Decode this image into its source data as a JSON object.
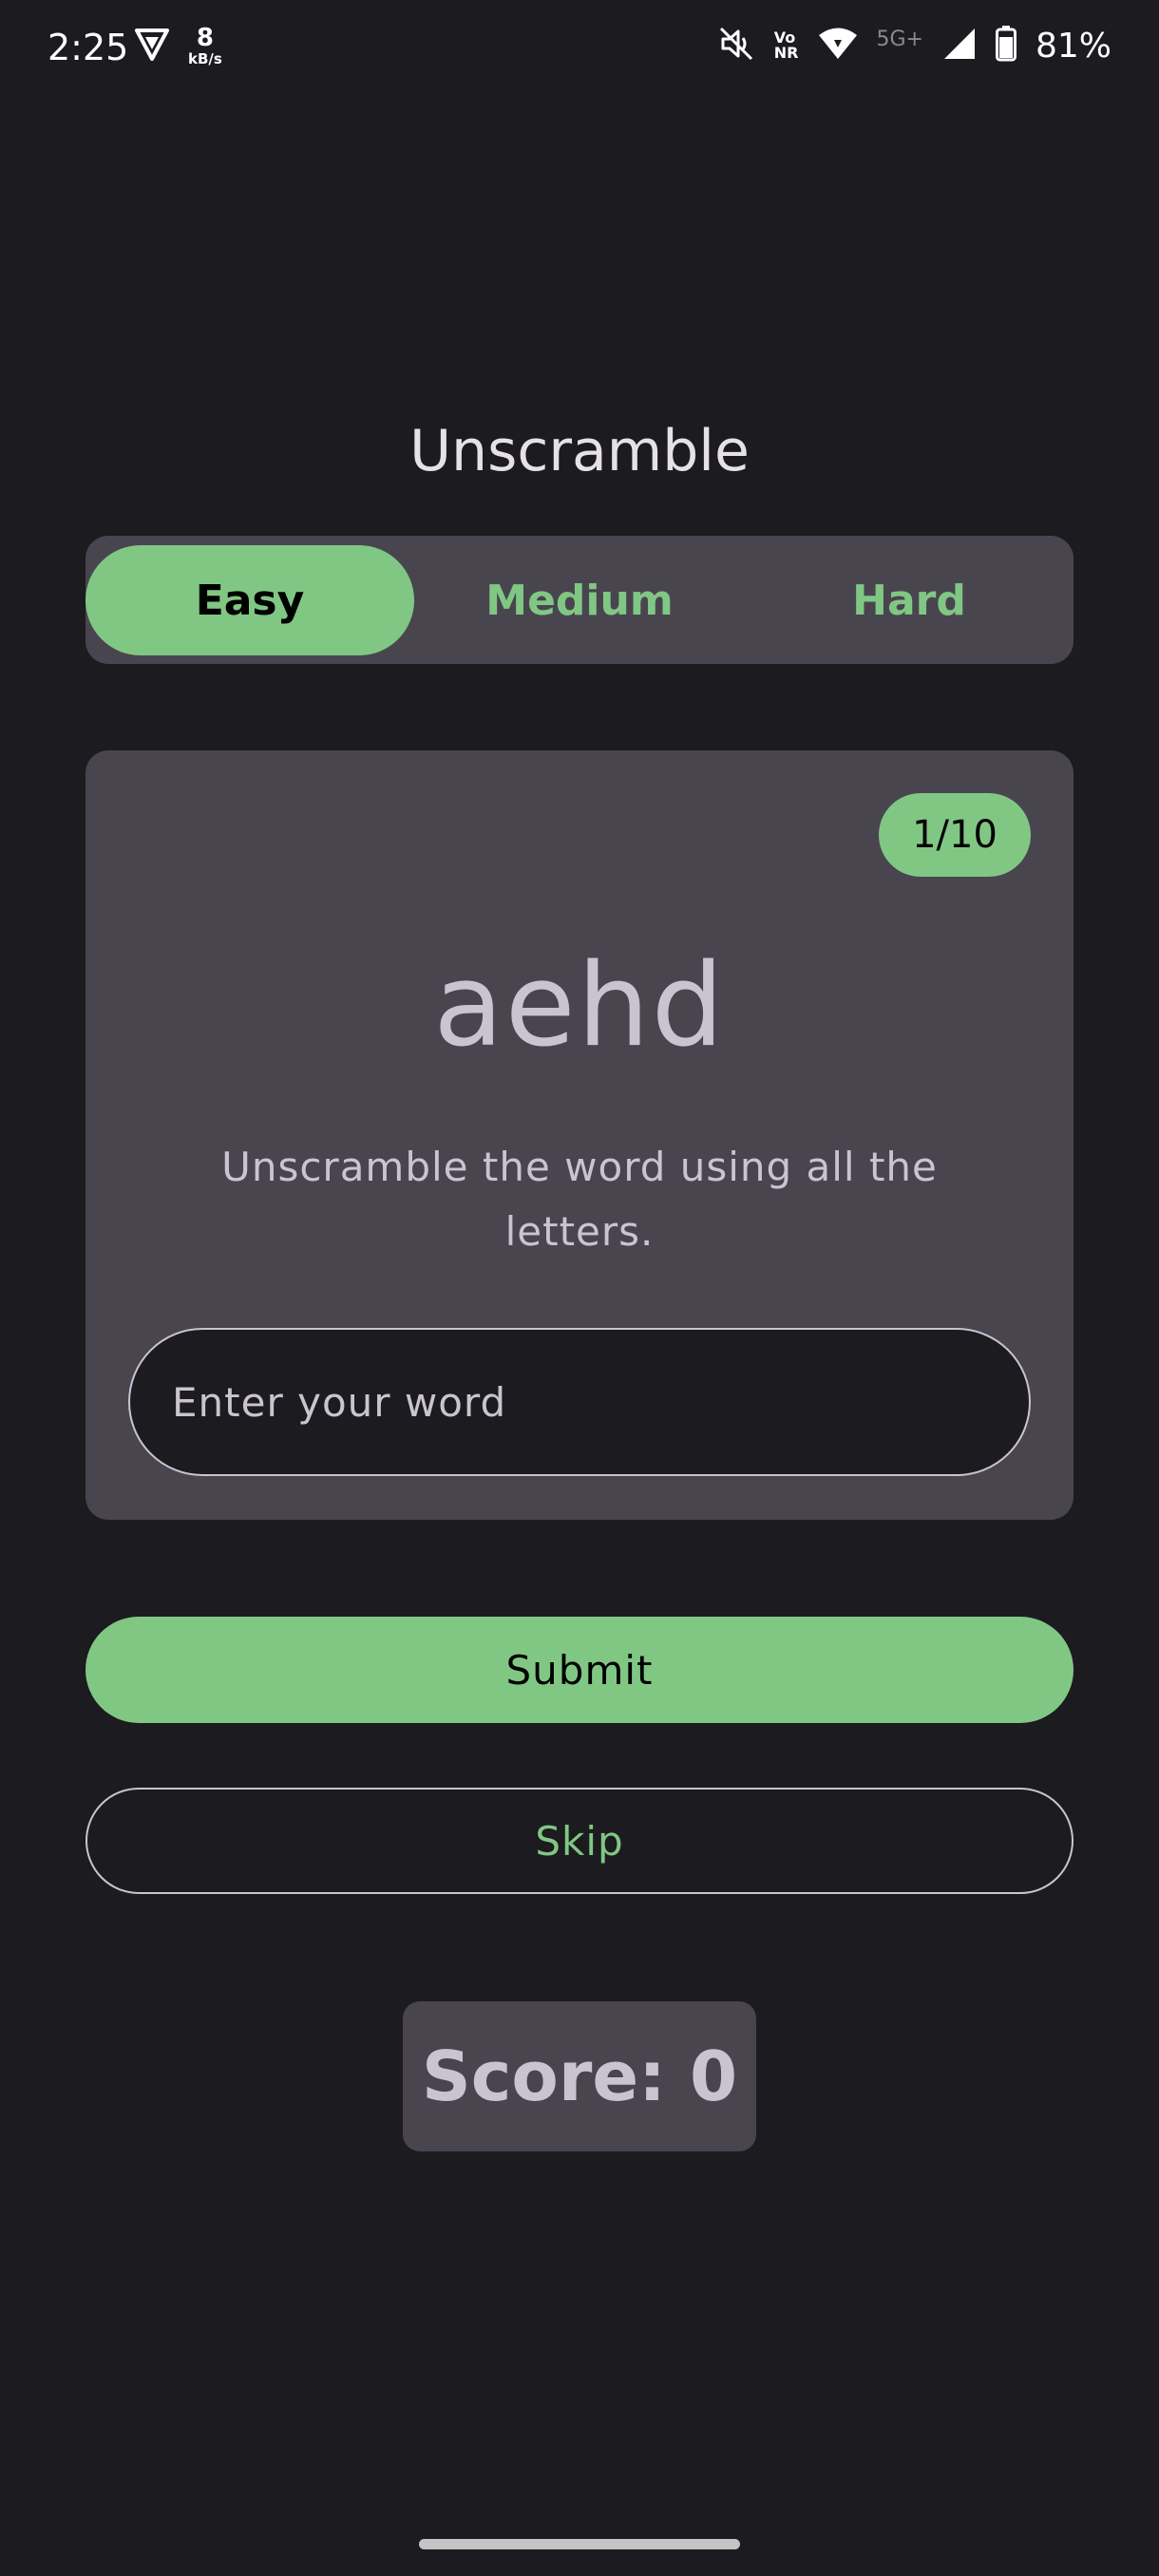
{
  "status_bar": {
    "time": "2:25",
    "net_speed_value": "8",
    "net_speed_unit": "kB/s",
    "volte_top": "Vo",
    "volte_bottom": "NR",
    "network_type": "5G+",
    "battery": "81%",
    "icons": [
      "vpn-shield-icon",
      "mute-icon",
      "wifi-icon",
      "signal-icon",
      "battery-icon"
    ]
  },
  "app": {
    "title": "Unscramble"
  },
  "difficulty": {
    "options": [
      "Easy",
      "Medium",
      "Hard"
    ],
    "selected": "Easy"
  },
  "game": {
    "counter": "1/10",
    "scrambled_word": "aehd",
    "instructions": "Unscramble the word using all the letters.",
    "input_placeholder": "Enter your word",
    "input_value": ""
  },
  "actions": {
    "submit_label": "Submit",
    "skip_label": "Skip"
  },
  "score": {
    "label": "Score: 0"
  },
  "colors": {
    "background": "#1c1b1f",
    "surface": "#49454f",
    "accent": "#81c784",
    "on_surface_variant": "#cac4d0"
  }
}
